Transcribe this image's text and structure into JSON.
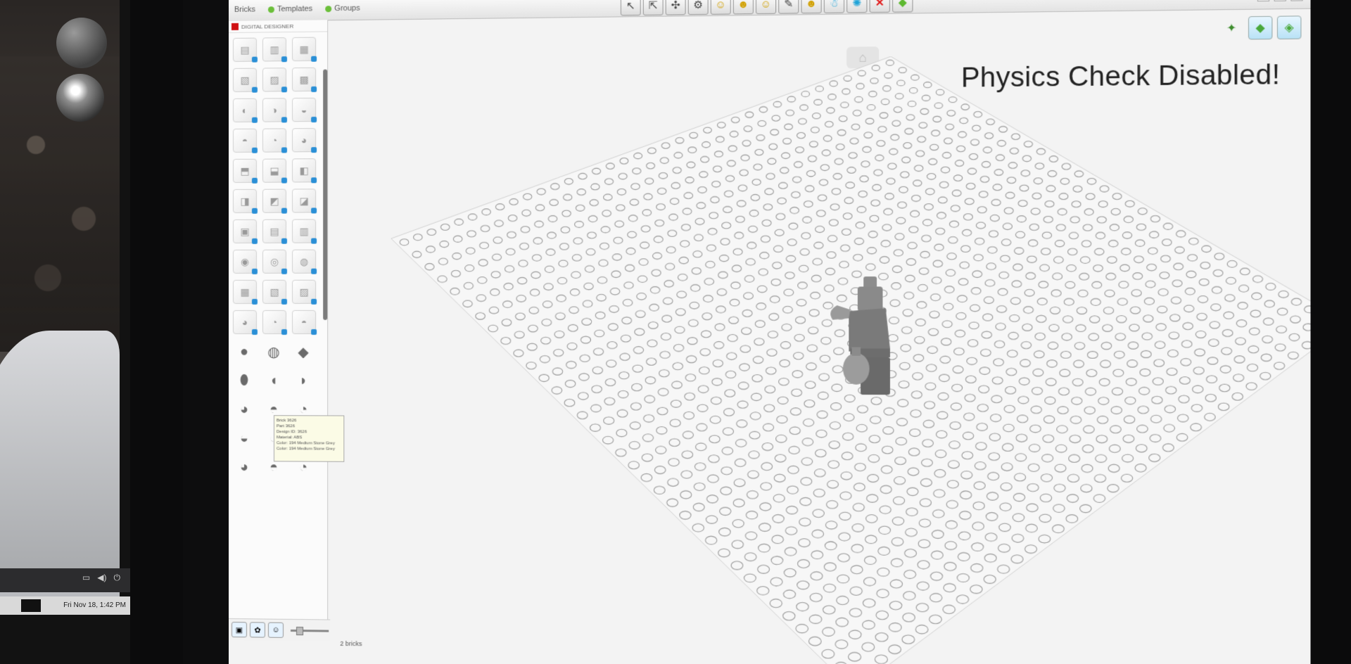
{
  "left_screen": {
    "clock": "Fri Nov 18,  1:42 PM"
  },
  "app": {
    "menu": [
      {
        "label": "Bricks"
      },
      {
        "label": "Templates"
      },
      {
        "label": "Groups"
      }
    ],
    "palette_title": "DIGITAL DESIGNER",
    "tooltip": "Brick 3626\nPart 3626\nDesign ID: 3626\nMaterial: ABS\nColor: 194 Medium Stone Grey\nColor: 194 Medium Stone Grey",
    "viewport_message": "Physics Check Disabled!",
    "status": "2 bricks"
  },
  "toolbar": {
    "tools": [
      {
        "icon": "select-arrow-icon"
      },
      {
        "icon": "multi-select-icon"
      },
      {
        "icon": "connect-icon"
      },
      {
        "icon": "hinge-icon"
      },
      {
        "icon": "flex-icon"
      },
      {
        "icon": "clone-icon"
      },
      {
        "icon": "hide-icon"
      },
      {
        "icon": "paint-icon"
      },
      {
        "icon": "decorate-icon"
      },
      {
        "icon": "minifig-icon"
      },
      {
        "icon": "gear-icon"
      },
      {
        "icon": "delete-icon"
      },
      {
        "icon": "build-icon"
      }
    ]
  },
  "colors": {
    "accent_red": "#d01012",
    "accent_blue": "#2a8fd6",
    "accent_green": "#5db830"
  }
}
